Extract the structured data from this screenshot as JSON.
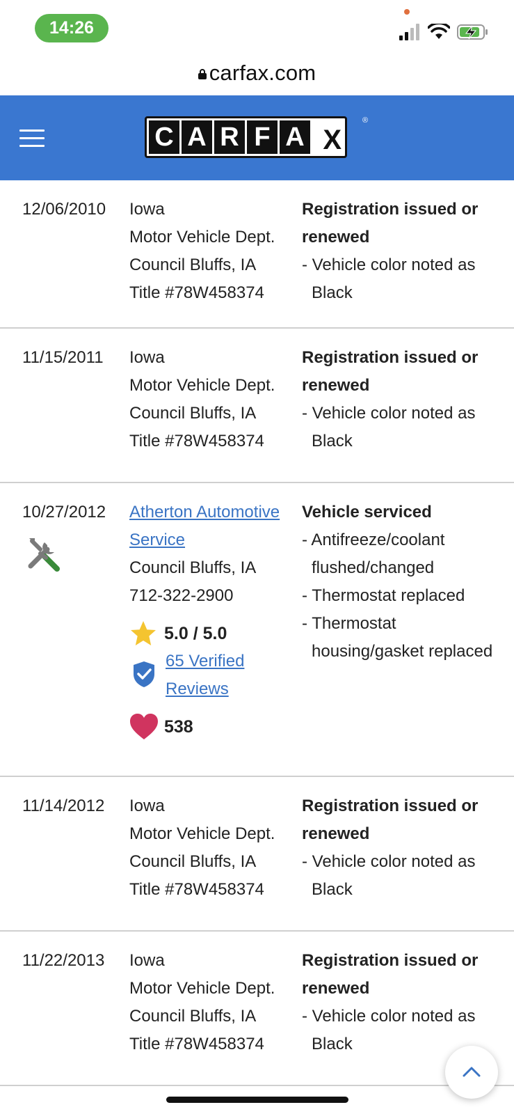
{
  "status_bar": {
    "time": "14:26"
  },
  "browser": {
    "url": "carfax.com"
  },
  "header": {
    "logo_letters": [
      "C",
      "A",
      "R",
      "F",
      "A",
      "X"
    ],
    "trademark": "®"
  },
  "colors": {
    "header_bg": "#3a77d0",
    "time_pill": "#5ab54e",
    "link": "#3a74c4",
    "star": "#f4c430",
    "heart": "#d0345f",
    "shield": "#3a74c4"
  },
  "records": [
    {
      "date": "12/06/2010",
      "source": [
        "Iowa",
        "Motor Vehicle Dept.",
        "Council Bluffs, IA",
        "Title #78W458374"
      ],
      "comment_title": "Registration issued or renewed",
      "comments": [
        "- Vehicle color noted as Black"
      ]
    },
    {
      "date": "11/15/2011",
      "source": [
        "Iowa",
        "Motor Vehicle Dept.",
        "Council Bluffs, IA",
        "Title #78W458374"
      ],
      "comment_title": "Registration issued or renewed",
      "comments": [
        "- Vehicle color noted as Black"
      ]
    },
    {
      "date": "10/27/2012",
      "icon": "service-tools-icon",
      "source_link": "Atherton Automotive Service",
      "source": [
        "Council Bluffs, IA",
        "712-322-2900"
      ],
      "rating": "5.0 / 5.0",
      "reviews_link": "65 Verified Reviews",
      "favorites": "538",
      "comment_title": "Vehicle serviced",
      "comments": [
        "- Antifreeze/coolant flushed/changed",
        "- Thermostat replaced",
        "- Thermostat housing/gasket replaced"
      ]
    },
    {
      "date": "11/14/2012",
      "source": [
        "Iowa",
        "Motor Vehicle Dept.",
        "Council Bluffs, IA",
        "Title #78W458374"
      ],
      "comment_title": "Registration issued or renewed",
      "comments": [
        "- Vehicle color noted as Black"
      ]
    },
    {
      "date": "11/22/2013",
      "source": [
        "Iowa",
        "Motor Vehicle Dept.",
        "Council Bluffs, IA",
        "Title #78W458374"
      ],
      "comment_title": "Registration issued or renewed",
      "comments": [
        "- Vehicle color noted as Black"
      ]
    }
  ]
}
